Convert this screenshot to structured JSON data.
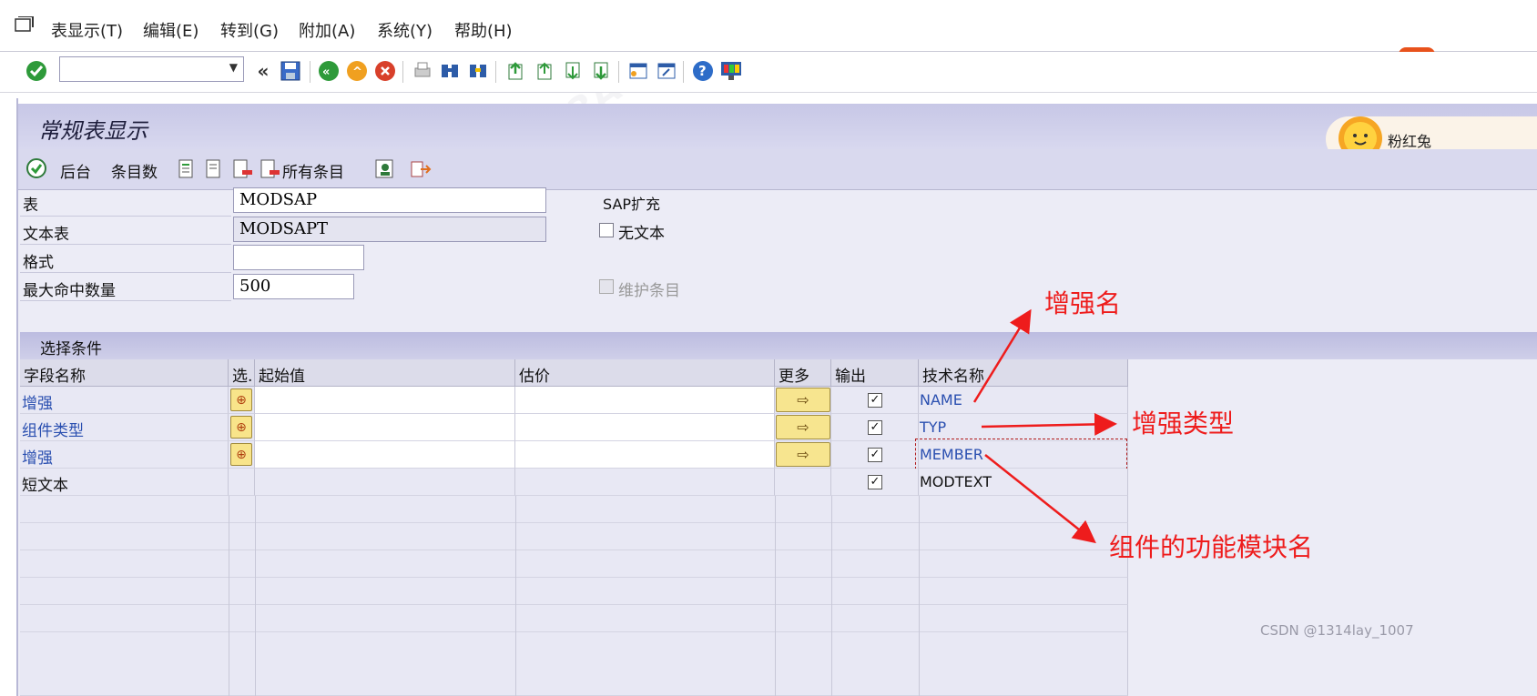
{
  "menubar": {
    "items": [
      {
        "label": "表显示(T)"
      },
      {
        "label": "编辑(E)"
      },
      {
        "label": "转到(G)"
      },
      {
        "label": "附加(A)"
      },
      {
        "label": "系统(Y)"
      },
      {
        "label": "帮助(H)"
      }
    ],
    "command_field_value": ""
  },
  "title": "常规表显示",
  "app_toolbar": {
    "background_label": "后台",
    "entries_label": "条目数",
    "all_entries_label": "所有条目"
  },
  "form": {
    "table_label": "表",
    "table_value": "MODSAP",
    "text_table_label": "文本表",
    "text_table_value": "MODSAPT",
    "format_label": "格式",
    "format_value": "",
    "max_hits_label": "最大命中数量",
    "max_hits_value": "500",
    "sap_ext_label": "SAP扩充",
    "no_text_label": "无文本",
    "maintain_entries_label": "维护条目"
  },
  "selection": {
    "header": "选择条件",
    "columns": [
      "字段名称",
      "选.",
      "起始值",
      "估价",
      "更多",
      "输出",
      "技术名称"
    ],
    "rows": [
      {
        "field": "增强",
        "tech": "NAME",
        "output": true
      },
      {
        "field": "组件类型",
        "tech": "TYP",
        "output": true
      },
      {
        "field": "增强",
        "tech": "MEMBER",
        "output": true
      },
      {
        "field": "短文本",
        "tech": "MODTEXT",
        "output": true
      }
    ]
  },
  "annotations": {
    "a1": "增强名",
    "a2": "增强类型",
    "a3": "组件的功能模块名"
  },
  "overlay": {
    "pet_name": "粉红兔"
  },
  "watermark": {
    "csdn": "CSDN @1314lay_1007"
  },
  "colors": {
    "accent_red": "#ee1c1c",
    "title_bg": "#c7c7e6",
    "field_blue": "#2a4fb0"
  }
}
